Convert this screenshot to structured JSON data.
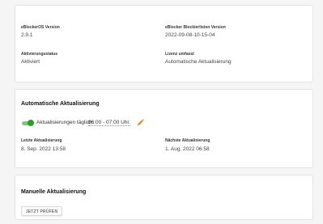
{
  "info": {
    "os_version_label": "eBlockerOS Version",
    "os_version_value": "2.9.1",
    "blocklist_version_label": "eBlocker Blockierlisten Version",
    "blocklist_version_value": "2022-09-08-10-15-04",
    "activation_label": "Aktivierungsstatus",
    "activation_value": "Aktiviert",
    "license_label": "Lizenz umfasst",
    "license_value": "Automatische Aktualisierung"
  },
  "auto_update": {
    "title": "Automatische Aktualisierung",
    "toggle_on": true,
    "schedule_label": "Aktualisierungen täglich:",
    "schedule_value": "06:00 - 07:00 Uhr.",
    "last_label": "Letzte Aktualisierung",
    "last_value": "8. Sep. 2022 13:58",
    "next_label": "Nächste Aktualisierung",
    "next_value": "1. Aug. 2022 06:58",
    "accent_color": "#2e9e2a",
    "edit_icon_color": "#f07800"
  },
  "manual_update": {
    "title": "Manuelle Aktualisierung",
    "button_label": "JETZT PRÜFEN"
  }
}
